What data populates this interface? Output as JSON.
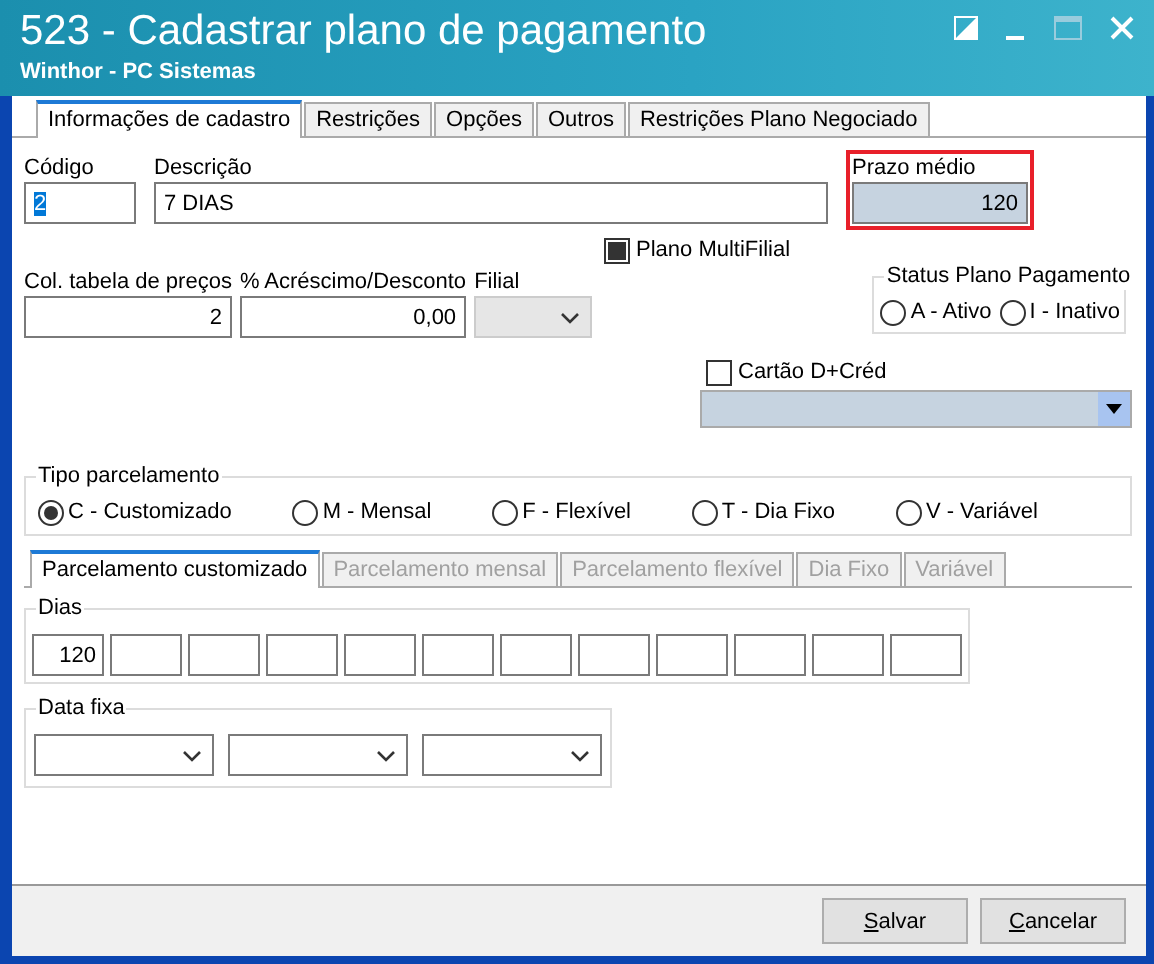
{
  "window": {
    "title": "523 - Cadastrar plano de pagamento",
    "subtitle": "Winthor - PC Sistemas"
  },
  "tabs": [
    {
      "label": "Informações de cadastro",
      "selected": true
    },
    {
      "label": "Restrições",
      "selected": false
    },
    {
      "label": "Opções",
      "selected": false
    },
    {
      "label": "Outros",
      "selected": false
    },
    {
      "label": "Restrições Plano Negociado",
      "selected": false
    }
  ],
  "fields_row1": [
    {
      "kind": "text",
      "label": "Código",
      "value": "2",
      "highlighted": false,
      "selected_text": true
    },
    {
      "kind": "text",
      "label": "Descrição",
      "value": "7 DIAS",
      "highlighted": false,
      "selected_text": false
    },
    {
      "kind": "readonly",
      "label": "Prazo médio",
      "value": "120",
      "highlighted": true,
      "selected_text": false
    }
  ],
  "plano_multifilial": {
    "label": "Plano MultiFilial",
    "checked": true
  },
  "fields_row2": [
    {
      "kind": "text",
      "label": "Col. tabela de preços",
      "value": "2"
    },
    {
      "kind": "text",
      "label": "% Acréscimo/Desconto",
      "value": "0,00"
    },
    {
      "kind": "dropdown",
      "label": "Filial",
      "disabled": true
    }
  ],
  "status_plano": {
    "title": "Status Plano Pagamento",
    "options": [
      {
        "label": "A - Ativo",
        "selected": false
      },
      {
        "label": "I - Inativo",
        "selected": false
      }
    ]
  },
  "cartao": {
    "label": "Cartão D+Créd",
    "checked": false
  },
  "tipo_parcelamento": {
    "title": "Tipo parcelamento",
    "options": [
      {
        "label": "C - Customizado",
        "selected": true
      },
      {
        "label": "M - Mensal",
        "selected": false
      },
      {
        "label": "F - Flexível",
        "selected": false
      },
      {
        "label": "T - Dia Fixo",
        "selected": false
      },
      {
        "label": "V - Variável",
        "selected": false
      }
    ]
  },
  "sub_tabs": [
    {
      "label": "Parcelamento customizado",
      "selected": true,
      "disabled": false
    },
    {
      "label": "Parcelamento mensal",
      "selected": false,
      "disabled": true
    },
    {
      "label": "Parcelamento flexível",
      "selected": false,
      "disabled": true
    },
    {
      "label": "Dia Fixo",
      "selected": false,
      "disabled": true
    },
    {
      "label": "Variável",
      "selected": false,
      "disabled": true
    }
  ],
  "dias": {
    "title": "Dias",
    "values": [
      "120"
    ]
  },
  "data_fixa": {
    "title": "Data fixa"
  },
  "buttons": [
    {
      "label": "Salvar"
    },
    {
      "label": "Cancelar"
    }
  ]
}
